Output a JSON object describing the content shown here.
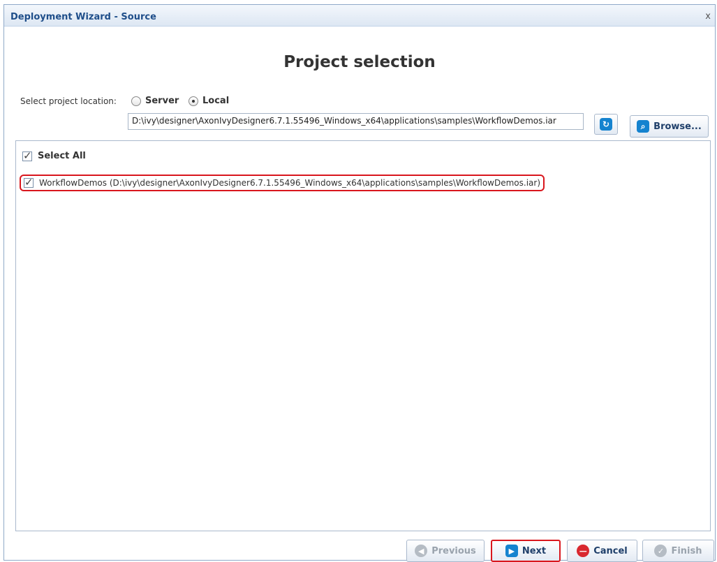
{
  "window": {
    "title": "Deployment Wizard - Source",
    "close_glyph": "x"
  },
  "heading": "Project selection",
  "location": {
    "label": "Select project location:",
    "options": [
      {
        "label": "Server",
        "selected": false
      },
      {
        "label": "Local",
        "selected": true
      }
    ],
    "path_value": "D:\\ivy\\designer\\AxonIvyDesigner6.7.1.55496_Windows_x64\\applications\\samples\\WorkflowDemos.iar",
    "refresh_icon": "refresh-icon",
    "browse_label": "Browse...",
    "browse_icon": "search-icon"
  },
  "projects": {
    "select_all_label": "Select All",
    "select_all_checked": true,
    "items": [
      {
        "label": "WorkflowDemos (D:\\ivy\\designer\\AxonIvyDesigner6.7.1.55496_Windows_x64\\applications\\samples\\WorkflowDemos.iar)",
        "checked": true
      }
    ]
  },
  "footer": {
    "previous_label": "Previous",
    "next_label": "Next",
    "cancel_label": "Cancel",
    "finish_label": "Finish"
  },
  "colors": {
    "highlight": "#d9161d",
    "accent": "#1583cf",
    "title": "#1f4e8a"
  }
}
